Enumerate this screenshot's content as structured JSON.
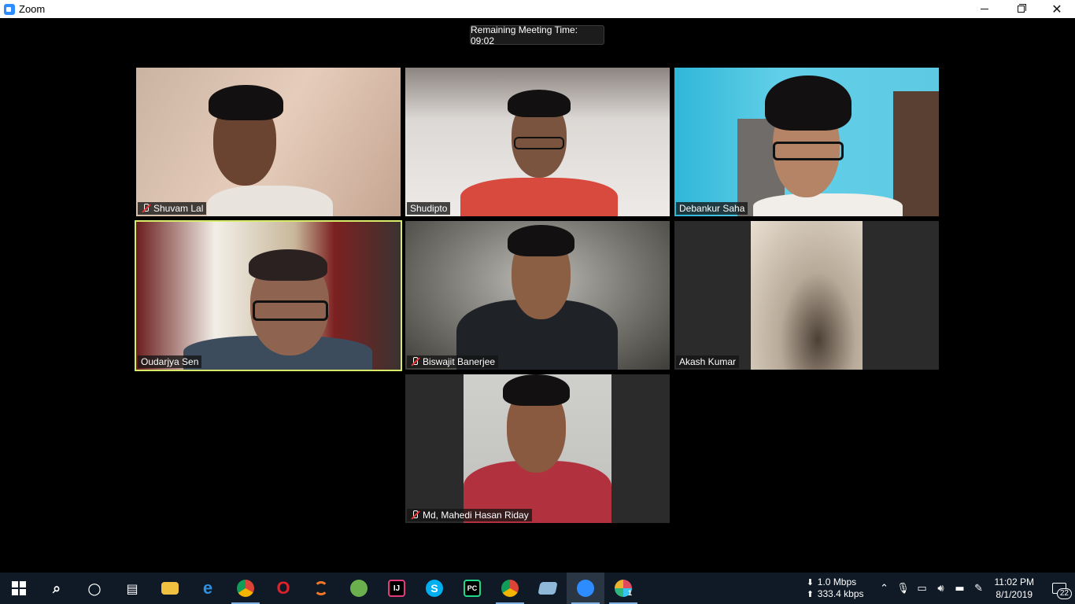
{
  "window": {
    "title": "Zoom",
    "minimize_label": "",
    "restore_label": "",
    "close_label": "✕"
  },
  "meeting": {
    "remaining_time": "Remaining Meeting Time: 09:02"
  },
  "participants": [
    {
      "name": "Shuvam Lal",
      "muted": true
    },
    {
      "name": "Shudipto",
      "muted": false
    },
    {
      "name": "Debankur Saha",
      "muted": false
    },
    {
      "name": "Oudarjya Sen",
      "muted": false,
      "active_speaker": true
    },
    {
      "name": "Biswajit Banerjee",
      "muted": true
    },
    {
      "name": "Akash Kumar",
      "muted": false
    },
    {
      "name": "Md, Mahedi Hasan Riday",
      "muted": true
    }
  ],
  "taskbar": {
    "apps": [
      {
        "icon": "search-icon",
        "glyph": "⌕"
      },
      {
        "icon": "cortana-icon",
        "glyph": "○"
      },
      {
        "icon": "task-view-icon",
        "glyph": "▤"
      },
      {
        "icon": "file-explorer-icon",
        "glyph": ""
      },
      {
        "icon": "edge-icon",
        "glyph": "e"
      },
      {
        "icon": "chrome-icon",
        "glyph": ""
      },
      {
        "icon": "opera-icon",
        "glyph": "O"
      },
      {
        "icon": "jupyter-icon",
        "glyph": ""
      },
      {
        "icon": "android-studio-icon",
        "glyph": ""
      },
      {
        "icon": "intellij-icon",
        "glyph": "IJ"
      },
      {
        "icon": "skype-icon",
        "glyph": "S"
      },
      {
        "icon": "pycharm-icon",
        "glyph": "PC"
      },
      {
        "icon": "chrome-profile-icon",
        "glyph": ""
      },
      {
        "icon": "notepad-icon",
        "glyph": ""
      },
      {
        "icon": "zoom-icon",
        "glyph": ""
      },
      {
        "icon": "app-notification-icon",
        "glyph": "1"
      }
    ],
    "network": {
      "down": "1.0 Mbps",
      "up": "333.4 kbps"
    },
    "clock": {
      "time": "11:02 PM",
      "date": "8/1/2019"
    },
    "notifications": {
      "count": "22"
    }
  },
  "colors": {
    "accent": "#2d8cff",
    "active_speaker_border": "#d8ea6a",
    "taskbar_bg": "#0f1a26"
  }
}
